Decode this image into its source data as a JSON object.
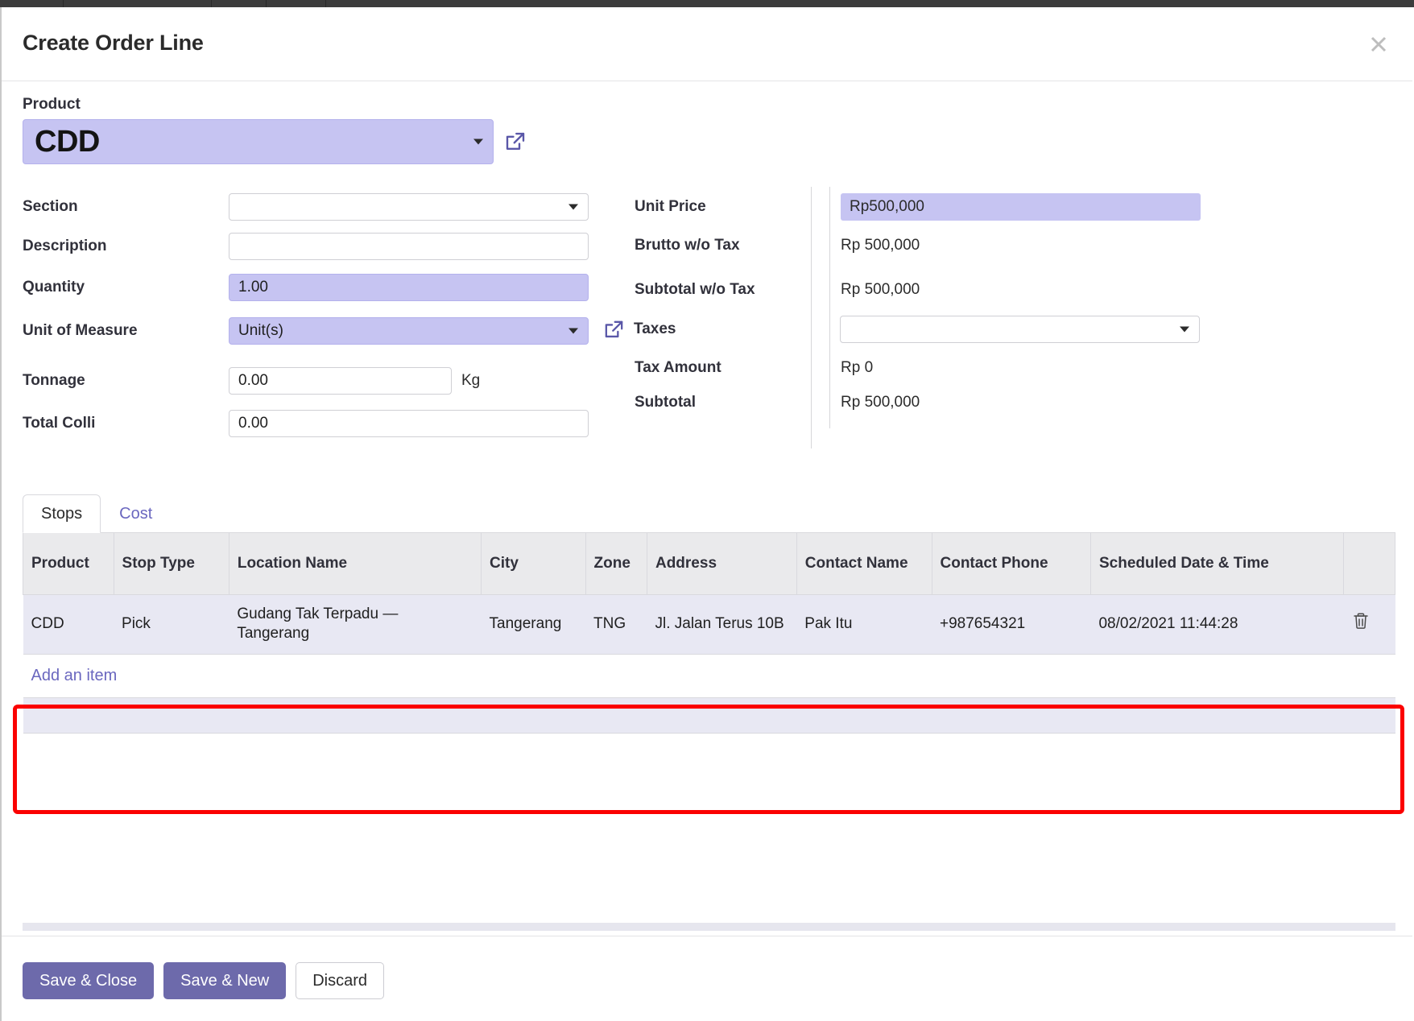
{
  "dialog": {
    "title": "Create Order Line",
    "close_icon": "close-icon"
  },
  "product": {
    "label": "Product",
    "value": "CDD",
    "external_link_icon": "external-link-icon"
  },
  "left_fields": [
    {
      "label": "Section",
      "value": "",
      "type": "select",
      "highlight": false
    },
    {
      "label": "Description",
      "value": "",
      "type": "text",
      "highlight": false
    },
    {
      "label": "Quantity",
      "value": "1.00",
      "type": "text",
      "highlight": true
    },
    {
      "label": "Unit of Measure",
      "value": "Unit(s)",
      "type": "select",
      "highlight": true
    },
    {
      "label": "Tonnage",
      "value": "0.00",
      "type": "text",
      "highlight": false,
      "suffix": "Kg"
    },
    {
      "label": "Total Colli",
      "value": "0.00",
      "type": "text",
      "highlight": false
    }
  ],
  "right_fields": {
    "unit_price_label": "Unit Price",
    "unit_price_value": "Rp500,000",
    "brutto_label": "Brutto w/o Tax",
    "brutto_value": "Rp 500,000",
    "subtotal_wo_tax_label": "Subtotal w/o Tax",
    "subtotal_wo_tax_value": "Rp 500,000",
    "taxes_label": "Taxes",
    "taxes_value": "",
    "taxes_external_link_icon": "external-link-icon",
    "tax_amount_label": "Tax Amount",
    "tax_amount_value": "Rp 0",
    "subtotal_label": "Subtotal",
    "subtotal_value": "Rp 500,000"
  },
  "tabs": [
    {
      "label": "Stops",
      "active": true
    },
    {
      "label": "Cost",
      "active": false
    }
  ],
  "table": {
    "columns": [
      "Product",
      "Stop Type",
      "Location Name",
      "City",
      "Zone",
      "Address",
      "Contact Name",
      "Contact Phone",
      "Scheduled Date & Time"
    ],
    "rows": [
      {
        "product": "CDD",
        "stop_type": "Pick",
        "location_name": "Gudang Tak Terpadu — Tangerang",
        "city": "Tangerang",
        "zone": "TNG",
        "address": "Jl. Jalan Terus 10B",
        "contact_name": "Pak Itu",
        "contact_phone": "+987654321",
        "scheduled": "08/02/2021 11:44:28",
        "delete_icon": "trash-icon"
      }
    ],
    "add_item_label": "Add an item"
  },
  "footer": {
    "save_close": "Save & Close",
    "save_new": "Save & New",
    "discard": "Discard"
  },
  "colors": {
    "accent": "#6d6aab",
    "field_highlight": "#c6c4f2",
    "row_highlight": "#e8e8f3",
    "annotation_red": "#fb0000",
    "header_bg": "#eaeaec"
  }
}
